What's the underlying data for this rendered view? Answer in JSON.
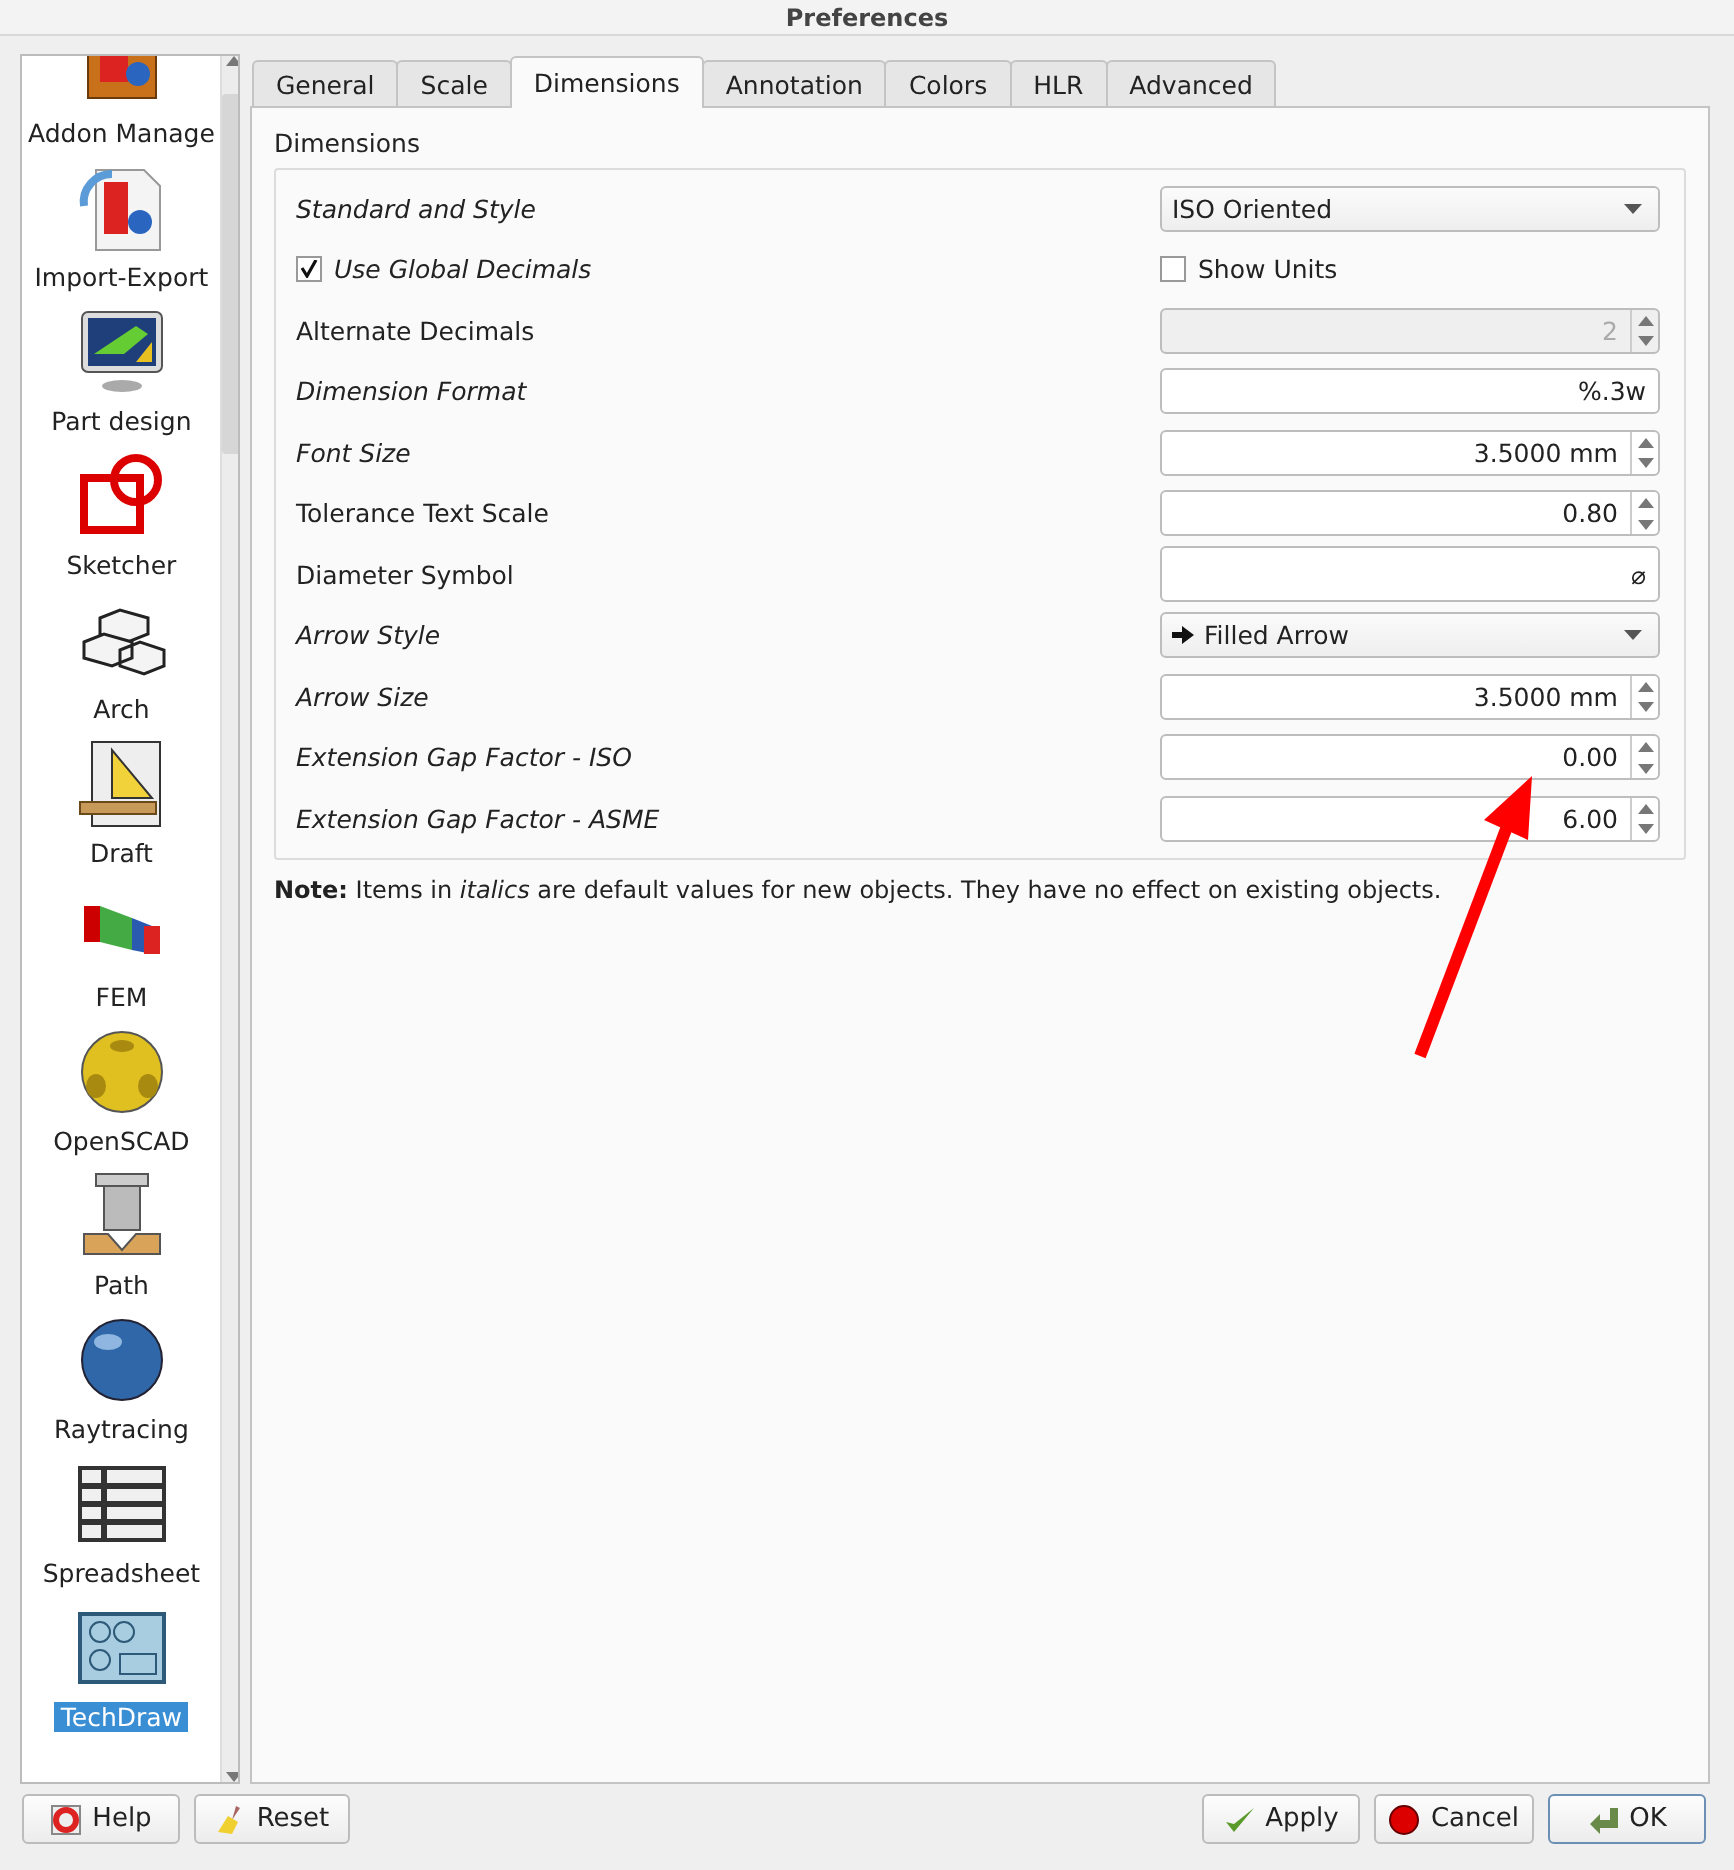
{
  "window": {
    "title": "Preferences"
  },
  "sidebar": {
    "items": [
      {
        "label": "Addon Manage",
        "kind": "addon",
        "selected": false
      },
      {
        "label": "Import-Export",
        "kind": "import",
        "selected": false
      },
      {
        "label": "Part design",
        "kind": "partdesign",
        "selected": false
      },
      {
        "label": "Sketcher",
        "kind": "sketcher",
        "selected": false
      },
      {
        "label": "Arch",
        "kind": "arch",
        "selected": false
      },
      {
        "label": "Draft",
        "kind": "draft",
        "selected": false
      },
      {
        "label": "FEM",
        "kind": "fem",
        "selected": false
      },
      {
        "label": "OpenSCAD",
        "kind": "openscad",
        "selected": false
      },
      {
        "label": "Path",
        "kind": "path",
        "selected": false
      },
      {
        "label": "Raytracing",
        "kind": "raytracing",
        "selected": false
      },
      {
        "label": "Spreadsheet",
        "kind": "spreadsheet",
        "selected": false
      },
      {
        "label": "TechDraw",
        "kind": "techdraw",
        "selected": true
      }
    ]
  },
  "tabs": [
    {
      "label": "General",
      "selected": false
    },
    {
      "label": "Scale",
      "selected": false
    },
    {
      "label": "Dimensions",
      "selected": true
    },
    {
      "label": "Annotation",
      "selected": false
    },
    {
      "label": "Colors",
      "selected": false
    },
    {
      "label": "HLR",
      "selected": false
    },
    {
      "label": "Advanced",
      "selected": false
    }
  ],
  "group": {
    "title": "Dimensions",
    "rows": [
      {
        "kind": "combo",
        "label": "Standard and Style",
        "italic": true,
        "value": "ISO Oriented",
        "arrow_icon": false
      },
      {
        "kind": "checks",
        "label": "Use Global Decimals",
        "italic": true,
        "checked": true,
        "second_label": "Show Units",
        "second_checked": false
      },
      {
        "kind": "spin",
        "label": "Alternate Decimals",
        "italic": false,
        "value": "2",
        "disabled": true
      },
      {
        "kind": "text",
        "label": "Dimension Format",
        "italic": true,
        "value": "%.3w"
      },
      {
        "kind": "spin",
        "label": "Font Size",
        "italic": true,
        "value": "3.5000 mm",
        "disabled": false
      },
      {
        "kind": "spin",
        "label": "Tolerance Text Scale",
        "italic": false,
        "value": "0.80",
        "disabled": false
      },
      {
        "kind": "text",
        "label": "Diameter Symbol",
        "italic": false,
        "value": "⌀"
      },
      {
        "kind": "combo",
        "label": "Arrow Style",
        "italic": true,
        "value": "Filled Arrow",
        "arrow_icon": true
      },
      {
        "kind": "spin",
        "label": "Arrow Size",
        "italic": true,
        "value": "3.5000 mm",
        "disabled": false
      },
      {
        "kind": "spin",
        "label": "Extension Gap Factor - ISO",
        "italic": true,
        "value": "0.00",
        "disabled": false
      },
      {
        "kind": "spin",
        "label": "Extension Gap Factor - ASME",
        "italic": true,
        "value": "6.00",
        "disabled": false
      }
    ]
  },
  "note": "**Note:** Items in *italics* are default values for new objects. They have no effect on existing objects.",
  "buttons": [
    {
      "label": "Help",
      "kind": "help",
      "default": false
    },
    {
      "label": "Reset",
      "kind": "reset",
      "default": false
    },
    {
      "label": "Apply",
      "kind": "apply",
      "default": false
    },
    {
      "label": "Cancel",
      "kind": "cancel",
      "default": false
    },
    {
      "label": "OK",
      "kind": "ok",
      "default": true
    }
  ]
}
